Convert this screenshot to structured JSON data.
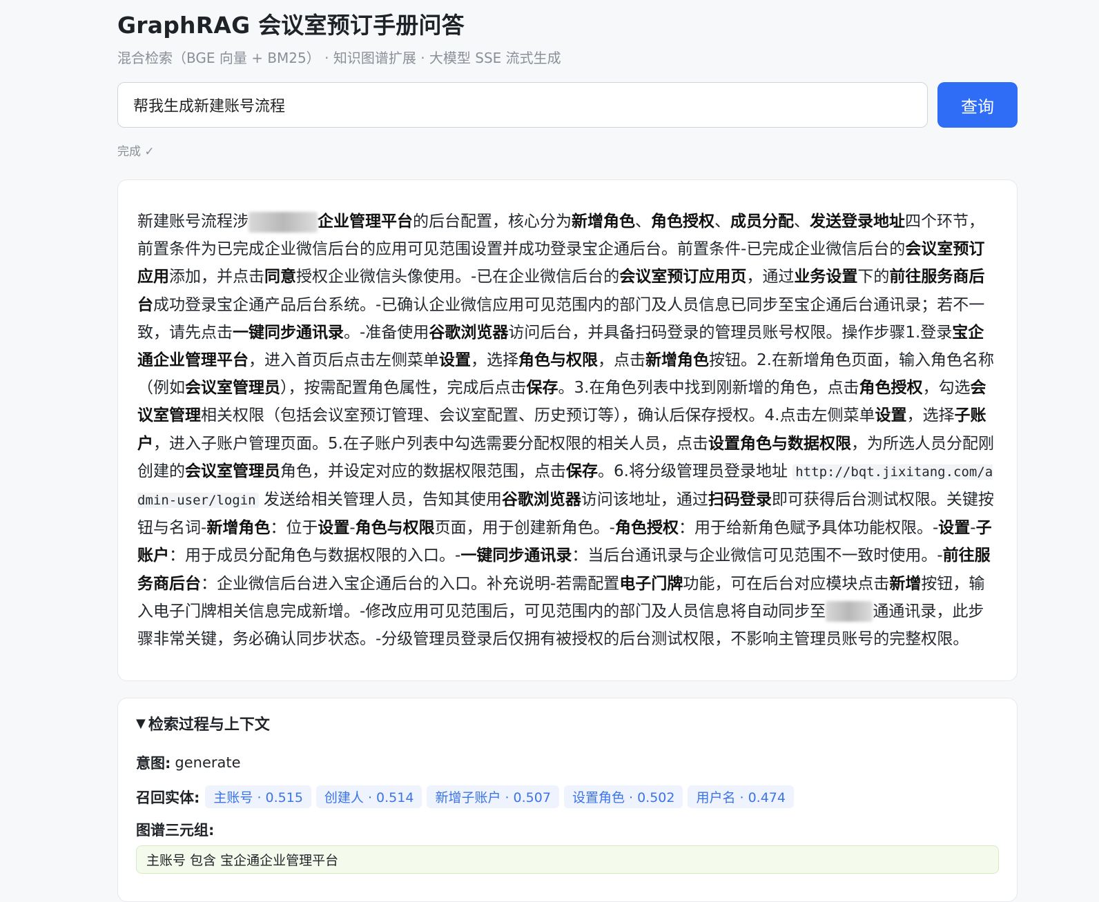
{
  "header": {
    "title": "GraphRAG 会议室预订手册问答",
    "subtitle": "混合检索（BGE 向量 + BM25） · 知识图谱扩展 · 大模型 SSE 流式生成"
  },
  "query": {
    "value": "帮我生成新建账号流程",
    "button_label": "查询"
  },
  "status": "完成 ✓",
  "answer": {
    "segments": [
      {
        "t": "新建账号流程涉"
      },
      {
        "blur": true,
        "w": 100
      },
      {
        "b": "企业管理平台"
      },
      {
        "t": "的后台配置，核心分为"
      },
      {
        "b": "新增角色"
      },
      {
        "t": "、"
      },
      {
        "b": "角色授权"
      },
      {
        "t": "、"
      },
      {
        "b": "成员分配"
      },
      {
        "t": "、"
      },
      {
        "b": "发送登录地址"
      },
      {
        "t": "四个环节，前置条件为已完成企业微信后台的应用可见范围设置并成功登录宝企通后台。前置条件-已完成企业微信后台的"
      },
      {
        "b": "会议室预订应用"
      },
      {
        "t": "添加，并点击"
      },
      {
        "b": "同意"
      },
      {
        "t": "授权企业微信头像使用。-已在企业微信后台的"
      },
      {
        "b": "会议室预订应用页"
      },
      {
        "t": "，通过"
      },
      {
        "b": "业务设置"
      },
      {
        "t": "下的"
      },
      {
        "b": "前往服务商后台"
      },
      {
        "t": "成功登录宝企通产品后台系统。-已确认企业微信应用可见范围内的部门及人员信息已同步至宝企通后台通讯录；若不一致，请先点击"
      },
      {
        "b": "一键同步通讯录"
      },
      {
        "t": "。-准备使用"
      },
      {
        "b": "谷歌浏览器"
      },
      {
        "t": "访问后台，并具备扫码登录的管理员账号权限。操作步骤1.登录"
      },
      {
        "b": "宝企通企业管理平台"
      },
      {
        "t": "，进入首页后点击左侧菜单"
      },
      {
        "b": "设置"
      },
      {
        "t": "，选择"
      },
      {
        "b": "角色与权限"
      },
      {
        "t": "，点击"
      },
      {
        "b": "新增角色"
      },
      {
        "t": "按钮。2.在新增角色页面，输入角色名称（例如"
      },
      {
        "b": "会议室管理员"
      },
      {
        "t": "），按需配置角色属性，完成后点击"
      },
      {
        "b": "保存"
      },
      {
        "t": "。3.在角色列表中找到刚新增的角色，点击"
      },
      {
        "b": "角色授权"
      },
      {
        "t": "，勾选"
      },
      {
        "b": "会议室管理"
      },
      {
        "t": "相关权限（包括会议室预订管理、会议室配置、历史预订等），确认后保存授权。4.点击左侧菜单"
      },
      {
        "b": "设置"
      },
      {
        "t": "，选择"
      },
      {
        "b": "子账户"
      },
      {
        "t": "，进入子账户管理页面。5.在子账户列表中勾选需要分配权限的相关人员，点击"
      },
      {
        "b": "设置角色与数据权限"
      },
      {
        "t": "，为所选人员分配刚创建的"
      },
      {
        "b": "会议室管理员"
      },
      {
        "t": "角色，并设定对应的数据权限范围，点击"
      },
      {
        "b": "保存"
      },
      {
        "t": "。6.将分级管理员登录地址 "
      },
      {
        "c": "http://bqt.jixitang.com/admin-user/login"
      },
      {
        "t": " 发送给相关管理人员，告知其使用"
      },
      {
        "b": "谷歌浏览器"
      },
      {
        "t": "访问该地址，通过"
      },
      {
        "b": "扫码登录"
      },
      {
        "t": "即可获得后台测试权限。关键按钮与名词-"
      },
      {
        "b": "新增角色"
      },
      {
        "t": "：位于"
      },
      {
        "b": "设置"
      },
      {
        "t": "-"
      },
      {
        "b": "角色与权限"
      },
      {
        "t": "页面，用于创建新角色。-"
      },
      {
        "b": "角色授权"
      },
      {
        "t": "：用于给新角色赋予具体功能权限。-"
      },
      {
        "b": "设置"
      },
      {
        "t": "-"
      },
      {
        "b": "子账户"
      },
      {
        "t": "：用于成员分配角色与数据权限的入口。-"
      },
      {
        "b": "一键同步通讯录"
      },
      {
        "t": "：当后台通讯录与企业微信可见范围不一致时使用。-"
      },
      {
        "b": "前往服务商后台"
      },
      {
        "t": "：企业微信后台进入宝企通后台的入口。补充说明-若需配置"
      },
      {
        "b": "电子门牌"
      },
      {
        "t": "功能，可在后台对应模块点击"
      },
      {
        "b": "新增"
      },
      {
        "t": "按钮，输入电子门牌相关信息完成新增。-修改应用可见范围后，可见范围内的部门及人员信息将自动同步至"
      },
      {
        "blur": true,
        "w": 68
      },
      {
        "t": "通通讯录，此步骤非常关键，务必确认同步状态。-分级管理员登录后仅拥有被授权的后台测试权限，不影响主管理员账号的完整权限。"
      }
    ]
  },
  "retrieval": {
    "summary": "检索过程与上下文",
    "intent_label": "意图:",
    "intent_value": "generate",
    "entities_label": "召回实体:",
    "entities": [
      "主账号 · 0.515",
      "创建人 · 0.514",
      "新增子账户 · 0.507",
      "设置角色 · 0.502",
      "用户名 · 0.474"
    ],
    "triples_label": "图谱三元组:",
    "triples": [
      "主账号 包含 宝企通企业管理平台"
    ]
  }
}
